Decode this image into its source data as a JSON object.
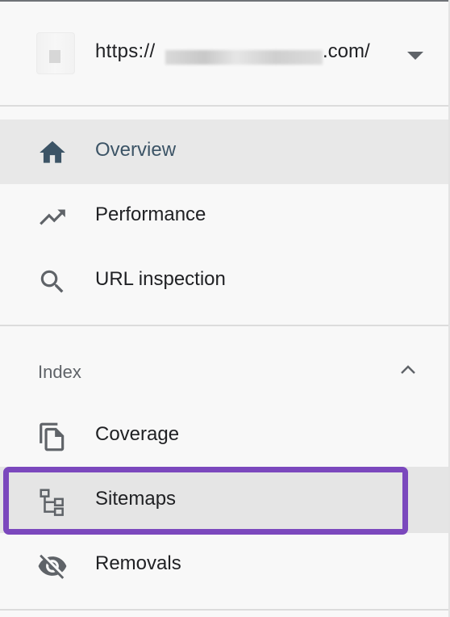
{
  "property": {
    "url_prefix": "https://",
    "url_suffix": ".com/",
    "dropdown_icon": "arrow-drop-down-icon"
  },
  "nav": {
    "items": [
      {
        "label": "Overview",
        "icon": "home-icon",
        "active": true
      },
      {
        "label": "Performance",
        "icon": "trending-up-icon"
      },
      {
        "label": "URL inspection",
        "icon": "search-icon"
      }
    ]
  },
  "index_section": {
    "label": "Index",
    "collapse_icon": "chevron-up-icon",
    "items": [
      {
        "label": "Coverage",
        "icon": "copy-icon"
      },
      {
        "label": "Sitemaps",
        "icon": "sitemap-icon",
        "highlighted": true
      },
      {
        "label": "Removals",
        "icon": "eye-off-icon"
      }
    ]
  },
  "colors": {
    "highlight": "#7b48bd",
    "active_text": "#3c5466",
    "icon": "#5f6368"
  }
}
